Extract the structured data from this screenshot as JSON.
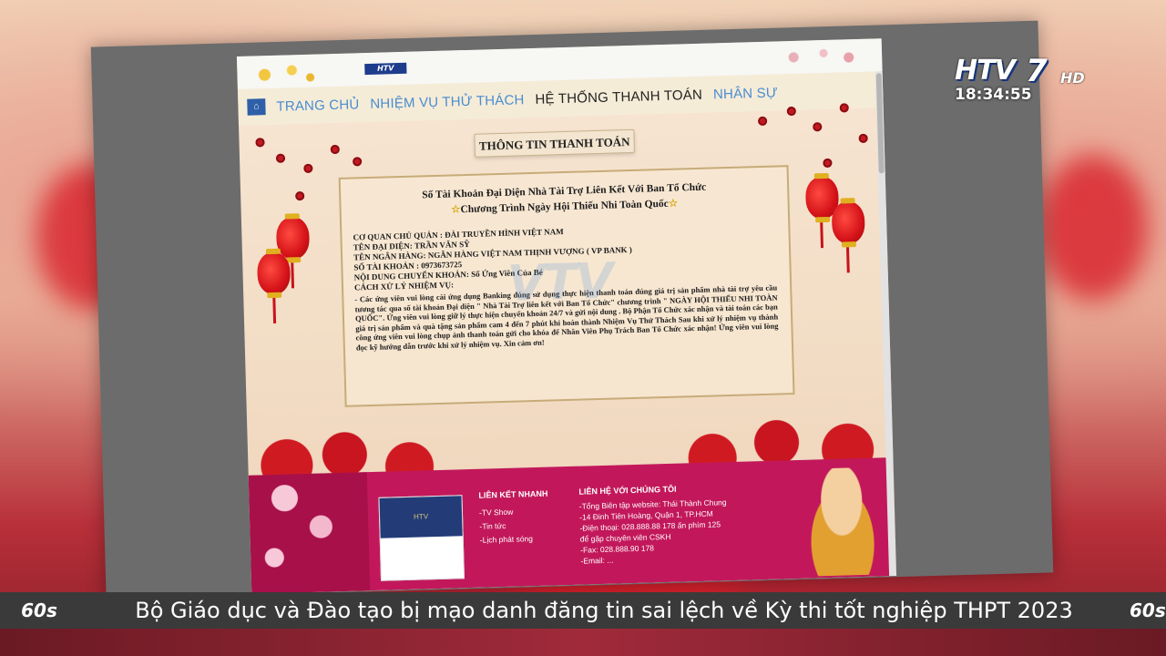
{
  "channel": {
    "logo_text": "HTV",
    "logo_number": "7",
    "logo_suffix": "HD",
    "clock": "18:34:55"
  },
  "ticker": {
    "badge": "60s",
    "headline": "Bộ Giáo dục và Đào tạo bị mạo danh đăng tin sai lệch về Kỳ thi tốt nghiệp THPT 2023"
  },
  "webpage": {
    "nav": {
      "items": [
        {
          "label": "TRANG CHỦ",
          "active": false
        },
        {
          "label": "NHIỆM VỤ THỬ THÁCH",
          "active": false
        },
        {
          "label": "HỆ THỐNG THANH TOÁN",
          "active": true
        },
        {
          "label": "NHÂN SỰ",
          "active": false
        }
      ]
    },
    "page_title": "THÔNG TIN THANH TOÁN",
    "box": {
      "heading1": "Số Tài Khoản Đại Diện Nhà Tài Trợ Liên Kết Với Ban Tổ Chức",
      "heading2": "Chương Trình Ngày Hội Thiếu Nhi Toàn Quốc",
      "lines": [
        "CƠ QUAN CHỦ QUẢN : ĐÀI TRUYỀN HÌNH VIỆT NAM",
        "TÊN ĐẠI DIỆN: TRẦN VĂN SỸ",
        "TÊN NGÂN HÀNG: NGÂN HÀNG VIỆT NAM THỊNH VƯỢNG ( VP BANK )",
        "SỐ TÀI KHOẢN : 0973673725",
        "NỘI DUNG CHUYỂN KHOẢN: Số Ứng Viên Của Bé",
        "CÁCH XỬ LÝ NHIỆM VỤ:"
      ],
      "paragraph": "- Các ứng viên vui lòng cài ứng dụng Banking đúng sử dụng thực hiện thanh toán đúng giá trị sản phẩm nhà tài trợ yêu cầu tương tác qua số tài khoản Đại diện \" Nhà Tài Trợ liên kết với Ban Tổ Chức\" chương trình \" NGÀY HỘI THIẾU NHI TOÀN QUỐC\". Ứng viên vui lòng giữ lý thực hiện chuyển khoản 24/7 và gửi nội dung . Bộ Phận Tổ Chức xác nhận và tài toán các bạn giá trị sản phẩm và quà tặng sản phẩm cam 4 đến 7 phút khi hoàn thành Nhiệm Vụ Thử Thách Sau khi xử lý nhiệm vụ thành công ứng viên vui lòng chụp ảnh thanh toán gửi cho khóa để Nhân Viên Phụ Trách Ban Tổ Chức xác nhận! Ứng viên vui lòng đọc kỹ hướng dẫn trước khi xử lý nhiệm vụ. Xin cảm ơn!"
    },
    "footer": {
      "card_label": "HTV",
      "col1_heading": "LIÊN KẾT NHANH",
      "col1_items": [
        "-TV Show",
        "-Tin tức",
        "-Lịch phát sóng"
      ],
      "col2_heading": "LIÊN HỆ VỚI CHÚNG TÔI",
      "col2_items": [
        "-Tổng Biên tập website: Thái Thành Chung",
        "-14 Đinh Tiên Hoàng, Quận 1, TP.HCM",
        "-Điện thoại: 028.888.88 178 ấn phím 125",
        "để gặp chuyên viên CSKH",
        "-Fax: 028.888.90 178",
        "-Email: ..."
      ]
    }
  },
  "colors": {
    "nav_link": "#4a8ccf",
    "footer_bg": "#c2185b",
    "ticker_bg": "#3a3a3a"
  }
}
